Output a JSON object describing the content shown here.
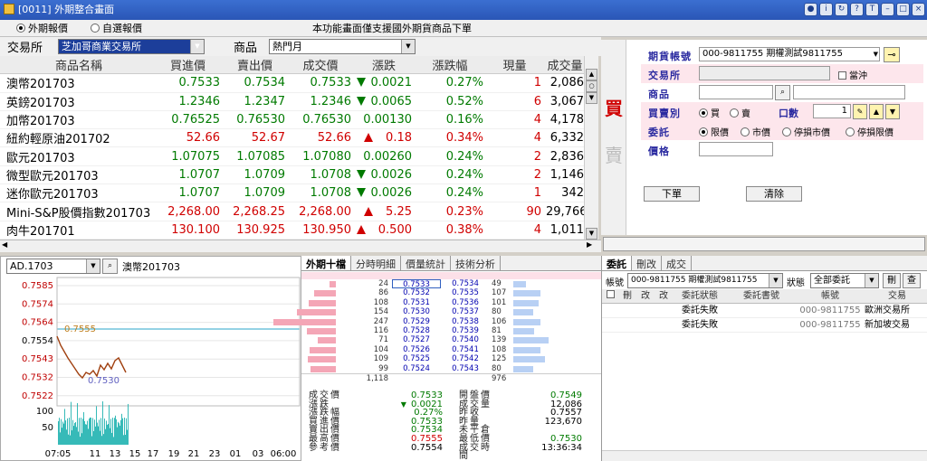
{
  "window": {
    "title": "[0011] 外期整合畫面"
  },
  "options": {
    "foreign": "外期報價",
    "custom": "自選報價",
    "notice": "本功能畫面僅支援國外期貨商品下單"
  },
  "filters": {
    "exchange_label": "交易所",
    "exchange_value": "芝加哥商業交易所",
    "product_label": "商品",
    "product_value": "熱門月"
  },
  "quotes": {
    "headers": [
      "商品名稱",
      "買進價",
      "賣出價",
      "成交價",
      "漲跌",
      "漲跌幅",
      "現量",
      "成交量"
    ],
    "rows": [
      {
        "name": "澳幣201703",
        "bid": "0.7533",
        "ask": "0.7534",
        "last": "0.7533",
        "dir": "down",
        "chg": "0.0021",
        "pct": "0.27%",
        "qty": "1",
        "vol": "2,086"
      },
      {
        "name": "英鎊201703",
        "bid": "1.2346",
        "ask": "1.2347",
        "last": "1.2346",
        "dir": "down",
        "chg": "0.0065",
        "pct": "0.52%",
        "qty": "6",
        "vol": "3,067"
      },
      {
        "name": "加幣201703",
        "bid": "0.76525",
        "ask": "0.76530",
        "last": "0.76530",
        "dir": "none",
        "chg": "0.00130",
        "pct": "0.16%",
        "qty": "4",
        "vol": "4,178"
      },
      {
        "name": "紐約輕原油201702",
        "bid": "52.66",
        "ask": "52.67",
        "last": "52.66",
        "dir": "up",
        "chg": "0.18",
        "pct": "0.34%",
        "qty": "4",
        "vol": "6,332"
      },
      {
        "name": "歐元201703",
        "bid": "1.07075",
        "ask": "1.07085",
        "last": "1.07080",
        "dir": "none",
        "chg": "0.00260",
        "pct": "0.24%",
        "qty": "2",
        "vol": "2,836"
      },
      {
        "name": "微型歐元201703",
        "bid": "1.0707",
        "ask": "1.0709",
        "last": "1.0708",
        "dir": "down",
        "chg": "0.0026",
        "pct": "0.24%",
        "qty": "2",
        "vol": "1,146"
      },
      {
        "name": "迷你歐元201703",
        "bid": "1.0707",
        "ask": "1.0709",
        "last": "1.0708",
        "dir": "down",
        "chg": "0.0026",
        "pct": "0.24%",
        "qty": "1",
        "vol": "342"
      },
      {
        "name": "Mini-S&P股價指數201703",
        "bid": "2,268.00",
        "ask": "2,268.25",
        "last": "2,268.00",
        "dir": "up",
        "chg": "5.25",
        "pct": "0.23%",
        "qty": "90",
        "vol": "29,766"
      },
      {
        "name": "肉牛201701",
        "bid": "130.100",
        "ask": "130.925",
        "last": "130.950",
        "dir": "up",
        "chg": "0.500",
        "pct": "0.38%",
        "qty": "4",
        "vol": "1,011"
      }
    ]
  },
  "order": {
    "buy_char": "買",
    "sell_char": "賣",
    "account_label": "期貨帳號",
    "account_value": "000-9811755  期權測試9811755",
    "exchange_label": "交易所",
    "daytrade": "當沖",
    "product_label": "商品",
    "side_label": "買賣別",
    "buy": "買",
    "sell": "賣",
    "qty_label": "口數",
    "qty_value": "1",
    "type_label": "委託",
    "type_limit": "限價",
    "type_market": "市價",
    "type_stop_market": "停損市價",
    "type_stop_limit": "停損限價",
    "price_label": "價格",
    "submit": "下單",
    "clear": "清除"
  },
  "chart": {
    "symbol": "AD.1703",
    "name": "澳幣201703",
    "yticks": [
      "0.7585",
      "0.7574",
      "0.7564",
      "0.7554",
      "0.7543",
      "0.7532",
      "0.7522"
    ],
    "vticks": [
      "100",
      "50"
    ],
    "xticks": [
      "07:05",
      "11",
      "13",
      "15",
      "17",
      "19",
      "21",
      "23",
      "01",
      "03",
      "06:00"
    ],
    "hi_label": "0.7555",
    "lo_label": "0.7530"
  },
  "ticks": {
    "tabs": [
      "外期十檔",
      "分時明細",
      "價量統計",
      "技術分析"
    ],
    "levels": [
      {
        "bq": "24",
        "bp": "0.7533",
        "ap": "0.7534",
        "aq": "49"
      },
      {
        "bq": "86",
        "bp": "0.7532",
        "ap": "0.7535",
        "aq": "107"
      },
      {
        "bq": "108",
        "bp": "0.7531",
        "ap": "0.7536",
        "aq": "101"
      },
      {
        "bq": "154",
        "bp": "0.7530",
        "ap": "0.7537",
        "aq": "80"
      },
      {
        "bq": "247",
        "bp": "0.7529",
        "ap": "0.7538",
        "aq": "106"
      },
      {
        "bq": "116",
        "bp": "0.7528",
        "ap": "0.7539",
        "aq": "81"
      },
      {
        "bq": "71",
        "bp": "0.7527",
        "ap": "0.7540",
        "aq": "139"
      },
      {
        "bq": "104",
        "bp": "0.7526",
        "ap": "0.7541",
        "aq": "108"
      },
      {
        "bq": "109",
        "bp": "0.7525",
        "ap": "0.7542",
        "aq": "125"
      },
      {
        "bq": "99",
        "bp": "0.7524",
        "ap": "0.7543",
        "aq": "80"
      }
    ],
    "bid_total": "1,118",
    "ask_total": "976",
    "stats": [
      {
        "l": "成交價",
        "v": "0.7533",
        "r": "開盤價",
        "rv": "0.7549"
      },
      {
        "l": "漲跌",
        "v": "0.0021",
        "r": "成交量",
        "rv": "12,086"
      },
      {
        "l": "漲跌幅",
        "v": "0.27%",
        "r": "昨收",
        "rv": "0.7557"
      },
      {
        "l": "買進價",
        "v": "0.7533",
        "r": "昨量",
        "rv": "123,670"
      },
      {
        "l": "賣出價",
        "v": "0.7534",
        "r": "未平倉",
        "rv": ""
      },
      {
        "l": "最高價",
        "v": "0.7555",
        "r": "最低價",
        "rv": "0.7530"
      },
      {
        "l": "參考價",
        "v": "0.7554",
        "r": "成交時間",
        "rv": "13:36:34"
      }
    ]
  },
  "orders": {
    "tabs": [
      "委託",
      "刪改",
      "成交"
    ],
    "account_label": "帳號",
    "account_value": "000-9811755 期權測試9811755",
    "status_label": "狀態",
    "status_value": "全部委託",
    "del_btn": "刪",
    "query_btn": "查",
    "headers": [
      "刪",
      "改",
      "改",
      "委託狀態",
      "委託書號",
      "帳號",
      "交易"
    ],
    "rows": [
      {
        "status": "委託失敗",
        "account": "000-9811755",
        "exchange": "歐洲交易所"
      },
      {
        "status": "委託失敗",
        "account": "000-9811755",
        "exchange": "新加坡交易"
      }
    ]
  },
  "colors": {
    "up": "#d00000",
    "down": "#007a00",
    "title": "#2a56b6"
  }
}
